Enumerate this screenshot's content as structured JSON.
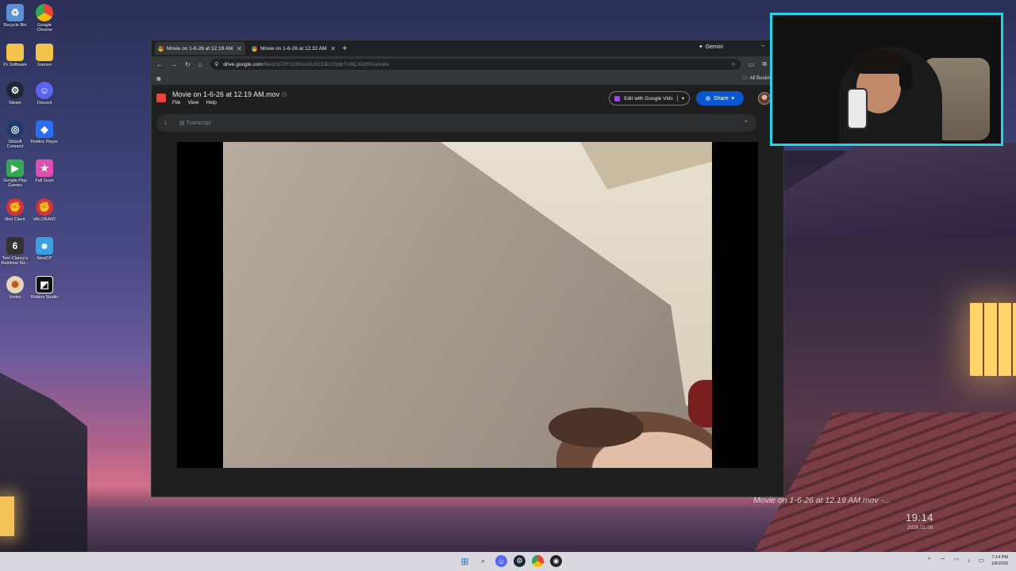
{
  "desktop": {
    "icons": [
      {
        "label": "Recycle Bin",
        "icon": "recycle-bin-icon",
        "color": "#5b8fd6"
      },
      {
        "label": "Google Chrome",
        "icon": "chrome-icon",
        "color": "#ea4335"
      },
      {
        "label": "Pc Software",
        "icon": "folder-icon",
        "color": "#f2c44e"
      },
      {
        "label": "Games",
        "icon": "folder-icon",
        "color": "#f2c44e"
      },
      {
        "label": "Steam",
        "icon": "steam-icon",
        "color": "#1b2838"
      },
      {
        "label": "Discord",
        "icon": "discord-icon",
        "color": "#5865f2"
      },
      {
        "label": "Ubisoft Connect",
        "icon": "ubisoft-icon",
        "color": "#1f3a6b"
      },
      {
        "label": "Roblox Player",
        "icon": "roblox-icon",
        "color": "#2b6ff0"
      },
      {
        "label": "Google Play Games",
        "icon": "google-play-icon",
        "color": "#34a853"
      },
      {
        "label": "Fall Guys",
        "icon": "fall-guys-icon",
        "color": "#e04fb0"
      },
      {
        "label": "Riot Client",
        "icon": "riot-icon",
        "color": "#d13639"
      },
      {
        "label": "VALORANT",
        "icon": "valorant-icon",
        "color": "#d13639"
      },
      {
        "label": "Tom Clancy's Rainbow Six...",
        "icon": "rainbow-six-icon",
        "color": "#333333"
      },
      {
        "label": "NewCP",
        "icon": "newcp-icon",
        "color": "#3aa0e0"
      },
      {
        "label": "Vortex",
        "icon": "vortex-icon",
        "color": "#ffffff"
      },
      {
        "label": "Roblox Studio",
        "icon": "roblox-studio-icon",
        "color": "#111111"
      }
    ]
  },
  "browser": {
    "tabs": [
      {
        "title": "Movie on 1-6-26 at 12.19 AM.mov",
        "active": true
      },
      {
        "title": "Movie on 1-6-26 at 12.32 AM.mov",
        "active": false
      }
    ],
    "new_tab": "+",
    "gemini_label": "Gemini",
    "url_domain": "drive.google.com",
    "url_path": "/file/d/1CPFr2I6SxoGLKCDEzJQdpTGBCXdzRGu/view",
    "bookmarks_label": "All Bookmarks"
  },
  "drive": {
    "file_title": "Movie on 1-6-26 at 12.19 AM.mov",
    "menus": [
      "File",
      "View",
      "Help"
    ],
    "edit_vids_label": "Edit with Google Vids",
    "share_label": "Share",
    "transcript_label": "Transcript"
  },
  "overlay": {
    "now_playing": "Movie on 1-6-26 at 12.19 AM.mov -...",
    "clock": "19:14",
    "date": "2026.01.08"
  },
  "taskbar": {
    "time": "7:14 PM",
    "date": "1/8/2026"
  },
  "colors": {
    "webcam_border": "#29d3e6",
    "share_button": "#0b57d0",
    "video_icon": "#e8453c"
  }
}
